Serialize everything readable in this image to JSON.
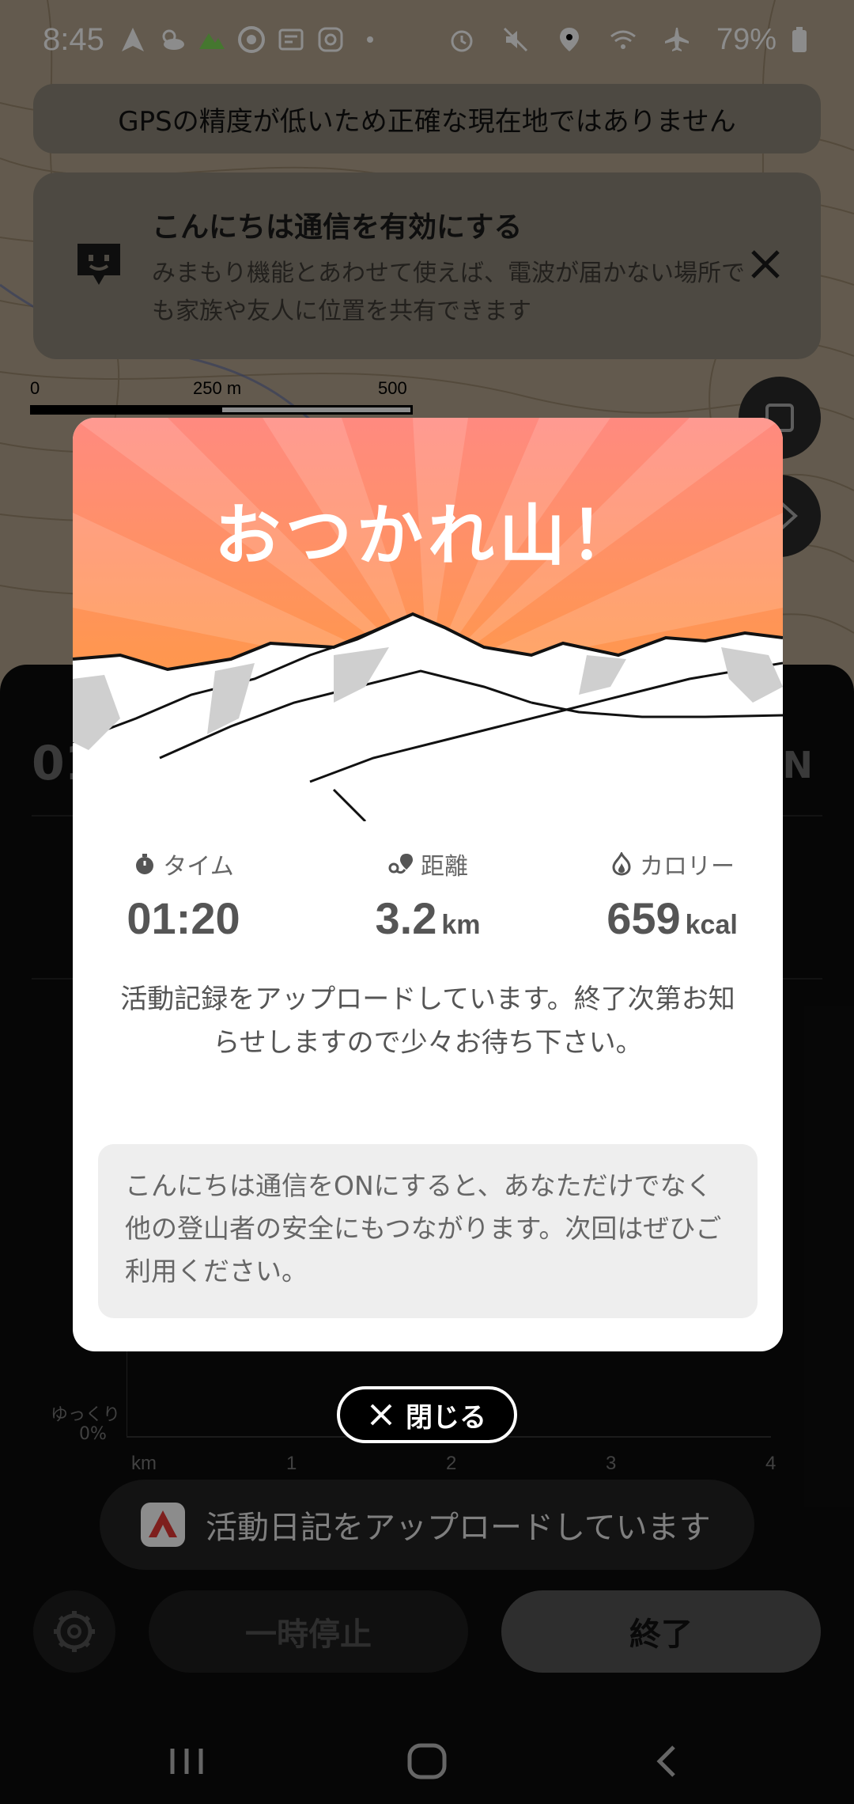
{
  "status_bar": {
    "time": "8:45",
    "battery": "79%"
  },
  "map": {
    "gps_warning": "GPSの精度が低いため正確な現在地ではありません",
    "scale": {
      "label_0": "0",
      "label_mid": "250 m",
      "label_end": "500 m"
    }
  },
  "konnichiwa_card": {
    "title": "こんにちは通信を有効にする",
    "description": "みまもり機能とあわせて使えば、電波が届かない場所でも家族や友人に位置を共有できます"
  },
  "sheet": {
    "big_time_partial": "01",
    "north_label": "N",
    "chart": {
      "slow_label": "ゆっくり",
      "pct_label": "0%",
      "x_unit": "km",
      "x_ticks": [
        "1",
        "2",
        "3",
        "4"
      ]
    }
  },
  "modal": {
    "headline": "おつかれ山！",
    "stats": [
      {
        "label": "タイム",
        "value": "01:20",
        "unit": ""
      },
      {
        "label": "距離",
        "value": "3.2",
        "unit": "km"
      },
      {
        "label": "カロリー",
        "value": "659",
        "unit": "kcal"
      }
    ],
    "message": "活動記録をアップロードしています。終了次第お知らせしますので少々お待ち下さい。",
    "note": "こんにちは通信をONにすると、あなただけでなく他の登山者の安全にもつながります。次回はぜひご利用ください。",
    "colors": {
      "banner_top": "#ff8a80",
      "banner_bottom": "#ff9800"
    }
  },
  "close_button": {
    "label": "閉じる"
  },
  "toast": {
    "text": "活動日記をアップロードしています"
  },
  "controls": {
    "pause_label": "一時停止",
    "end_label": "終了"
  }
}
